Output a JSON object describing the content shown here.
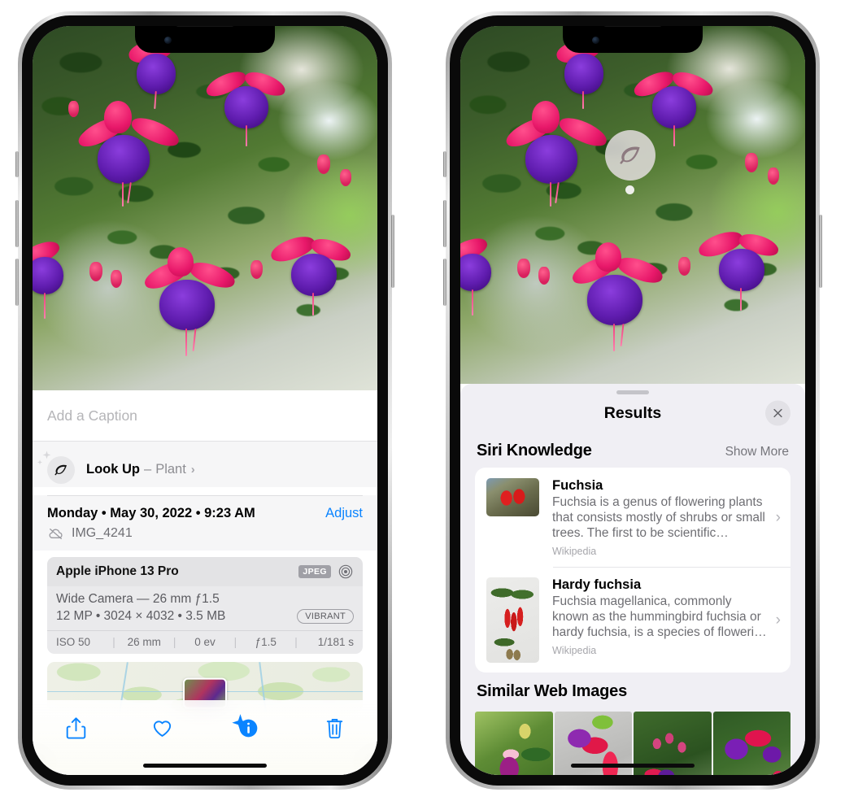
{
  "left_phone": {
    "photo": {
      "alt": "fuchsia-flowers-photo"
    },
    "caption_placeholder": "Add a Caption",
    "lookup": {
      "icon": "leaf-icon",
      "label": "Look Up",
      "dash": "–",
      "subject": "Plant",
      "chevron": "›"
    },
    "meta": {
      "datetime": "Monday • May 30, 2022 • 9:23 AM",
      "adjust_label": "Adjust",
      "cloud_icon": "icloud-slash-icon",
      "filename": "IMG_4241"
    },
    "camera_card": {
      "device": "Apple iPhone 13 Pro",
      "format_badge": "JPEG",
      "raw_icon": "aperture-icon",
      "lens_line": "Wide Camera — 26 mm ƒ1.5",
      "spec_line": "12 MP • 3024 × 4032 • 3.5 MB",
      "style_badge": "VIBRANT",
      "exif": [
        "ISO 50",
        "26 mm",
        "0 ev",
        "ƒ1.5",
        "1/181 s"
      ]
    },
    "toolbar": {
      "share_label": "share-icon",
      "favorite_label": "heart-icon",
      "info_label": "info-sparkle-icon",
      "delete_label": "trash-icon"
    }
  },
  "right_phone": {
    "photo_badge": {
      "icon": "leaf-icon"
    },
    "sheet": {
      "title": "Results",
      "close_icon": "close-icon"
    },
    "siri_knowledge": {
      "title": "Siri Knowledge",
      "action": "Show More",
      "items": [
        {
          "title": "Fuchsia",
          "description": "Fuchsia is a genus of flowering plants that consists mostly of shrubs or small trees. The first to be scientific…",
          "source": "Wikipedia",
          "chevron": "›"
        },
        {
          "title": "Hardy fuchsia",
          "description": "Fuchsia magellanica, commonly known as the hummingbird fuchsia or hardy fuchsia, is a species of floweri…",
          "source": "Wikipedia",
          "chevron": "›"
        }
      ]
    },
    "similar_web_images": {
      "title": "Similar Web Images",
      "tiles": [
        "web-image-1",
        "web-image-2",
        "web-image-3",
        "web-image-4"
      ]
    }
  },
  "colors": {
    "accent_blue": "#0a84ff",
    "sheet_bg": "#f0eff4",
    "card_bg": "#ffffff",
    "muted_text": "#6e6e73"
  }
}
